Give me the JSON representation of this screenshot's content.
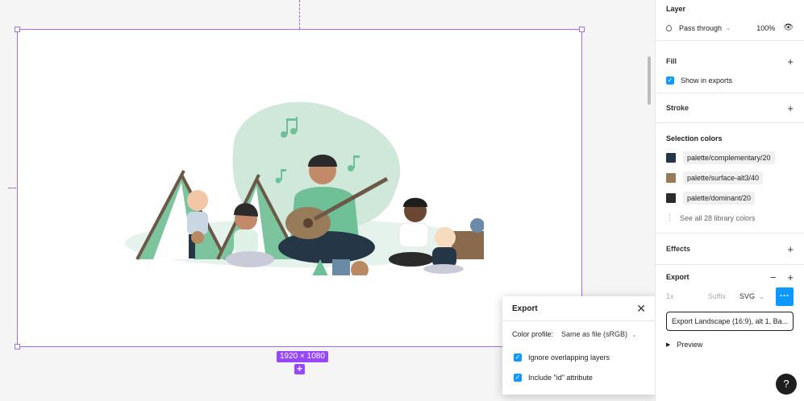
{
  "canvas": {
    "frame_size": "1920 × 1080",
    "add_symbol": "+"
  },
  "export_popup": {
    "title": "Export",
    "close_icon": "close-icon",
    "color_profile_label": "Color profile:",
    "color_profile_value": "Same as file (sRGB)",
    "options": [
      {
        "label": "Ignore overlapping layers",
        "checked": true
      },
      {
        "label": "Include \"id\" attribute",
        "checked": true
      }
    ]
  },
  "panel": {
    "layer": {
      "title": "Layer",
      "blend_mode": "Pass through",
      "opacity": "100%"
    },
    "fill": {
      "title": "Fill",
      "show_in_exports": "Show in exports"
    },
    "stroke": {
      "title": "Stroke"
    },
    "selection_colors": {
      "title": "Selection colors",
      "colors": [
        {
          "name": "palette/complementary/20",
          "hex": "#253746"
        },
        {
          "name": "palette/surface-alt3/40",
          "hex": "#987b58"
        },
        {
          "name": "palette/dominant/20",
          "hex": "#2b2b2b"
        }
      ],
      "see_all": "See all 28 library colors"
    },
    "effects": {
      "title": "Effects"
    },
    "export": {
      "title": "Export",
      "scale": "1x",
      "suffix": "Suffix",
      "format": "SVG",
      "more": "···",
      "button": "Export Landscape (16:9), alt 1, Ba...",
      "preview": "Preview"
    }
  },
  "help": "?",
  "colors": {
    "accent": "#0d99ff",
    "selection": "#9747ff"
  }
}
